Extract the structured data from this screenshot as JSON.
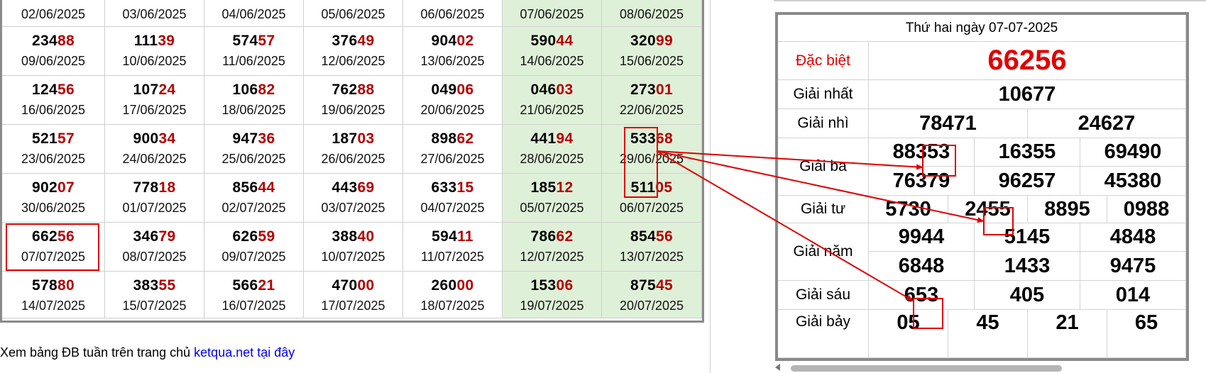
{
  "weekly_table": {
    "header_dates": [
      "02/06/2025",
      "03/06/2025",
      "04/06/2025",
      "05/06/2025",
      "06/06/2025",
      "07/06/2025",
      "08/06/2025"
    ],
    "rows": [
      [
        {
          "head": "234",
          "tail": "88",
          "date": "09/06/2025"
        },
        {
          "head": "111",
          "tail": "39",
          "date": "10/06/2025"
        },
        {
          "head": "574",
          "tail": "57",
          "date": "11/06/2025"
        },
        {
          "head": "376",
          "tail": "49",
          "date": "12/06/2025"
        },
        {
          "head": "904",
          "tail": "02",
          "date": "13/06/2025"
        },
        {
          "head": "590",
          "tail": "44",
          "date": "14/06/2025"
        },
        {
          "head": "320",
          "tail": "99",
          "date": "15/06/2025"
        }
      ],
      [
        {
          "head": "124",
          "tail": "56",
          "date": "16/06/2025"
        },
        {
          "head": "107",
          "tail": "24",
          "date": "17/06/2025"
        },
        {
          "head": "106",
          "tail": "82",
          "date": "18/06/2025"
        },
        {
          "head": "762",
          "tail": "88",
          "date": "19/06/2025"
        },
        {
          "head": "049",
          "tail": "06",
          "date": "20/06/2025"
        },
        {
          "head": "046",
          "tail": "03",
          "date": "21/06/2025"
        },
        {
          "head": "273",
          "tail": "01",
          "date": "22/06/2025"
        }
      ],
      [
        {
          "head": "521",
          "tail": "57",
          "date": "23/06/2025"
        },
        {
          "head": "900",
          "tail": "34",
          "date": "24/06/2025"
        },
        {
          "head": "947",
          "tail": "36",
          "date": "25/06/2025"
        },
        {
          "head": "187",
          "tail": "03",
          "date": "26/06/2025"
        },
        {
          "head": "898",
          "tail": "62",
          "date": "27/06/2025"
        },
        {
          "head": "441",
          "tail": "94",
          "date": "28/06/2025"
        },
        {
          "head": "533",
          "tail": "68",
          "date": "29/06/2025"
        }
      ],
      [
        {
          "head": "902",
          "tail": "07",
          "date": "30/06/2025"
        },
        {
          "head": "778",
          "tail": "18",
          "date": "01/07/2025"
        },
        {
          "head": "856",
          "tail": "44",
          "date": "02/07/2025"
        },
        {
          "head": "443",
          "tail": "69",
          "date": "03/07/2025"
        },
        {
          "head": "633",
          "tail": "15",
          "date": "04/07/2025"
        },
        {
          "head": "185",
          "tail": "12",
          "date": "05/07/2025"
        },
        {
          "head": "511",
          "tail": "05",
          "date": "06/07/2025"
        }
      ],
      [
        {
          "head": "662",
          "tail": "56",
          "date": "07/07/2025"
        },
        {
          "head": "346",
          "tail": "79",
          "date": "08/07/2025"
        },
        {
          "head": "626",
          "tail": "59",
          "date": "09/07/2025"
        },
        {
          "head": "388",
          "tail": "40",
          "date": "10/07/2025"
        },
        {
          "head": "594",
          "tail": "11",
          "date": "11/07/2025"
        },
        {
          "head": "786",
          "tail": "62",
          "date": "12/07/2025"
        },
        {
          "head": "854",
          "tail": "56",
          "date": "13/07/2025"
        }
      ],
      [
        {
          "head": "578",
          "tail": "80",
          "date": "14/07/2025"
        },
        {
          "head": "383",
          "tail": "55",
          "date": "15/07/2025"
        },
        {
          "head": "566",
          "tail": "21",
          "date": "16/07/2025"
        },
        {
          "head": "470",
          "tail": "00",
          "date": "17/07/2025"
        },
        {
          "head": "260",
          "tail": "00",
          "date": "18/07/2025"
        },
        {
          "head": "153",
          "tail": "06",
          "date": "19/07/2025"
        },
        {
          "head": "875",
          "tail": "45",
          "date": "20/07/2025"
        }
      ]
    ]
  },
  "footer": {
    "text": "Xem bảng ĐB tuần trên trang chủ ",
    "link": "ketqua.net tại đây"
  },
  "result": {
    "title": "Thứ hai ngày 07-07-2025",
    "special": {
      "label": "Đặc biệt",
      "value": "66256"
    },
    "first": {
      "label": "Giải nhất",
      "value": "10677"
    },
    "second": {
      "label": "Giải nhì",
      "values": [
        "78471",
        "24627"
      ]
    },
    "third": {
      "label": "Giải ba",
      "values": [
        "88353",
        "16355",
        "69490",
        "76379",
        "96257",
        "45380"
      ]
    },
    "fourth": {
      "label": "Giải tư",
      "values": [
        "5730",
        "2455",
        "8895",
        "0988"
      ]
    },
    "fifth": {
      "label": "Giải năm",
      "values": [
        "9944",
        "5145",
        "4848",
        "6848",
        "1433",
        "9475"
      ]
    },
    "sixth": {
      "label": "Giải sáu",
      "values": [
        "653",
        "405",
        "014"
      ]
    },
    "seventh": {
      "label": "Giải bảy",
      "values": [
        "05",
        "45",
        "21",
        "65"
      ]
    }
  },
  "colors": {
    "highlight_border": "#e00000",
    "weekend_bg": "#dff0d8",
    "tail_digits": "#b30000",
    "special_prize": "#e00000",
    "link": "#0000ee"
  }
}
